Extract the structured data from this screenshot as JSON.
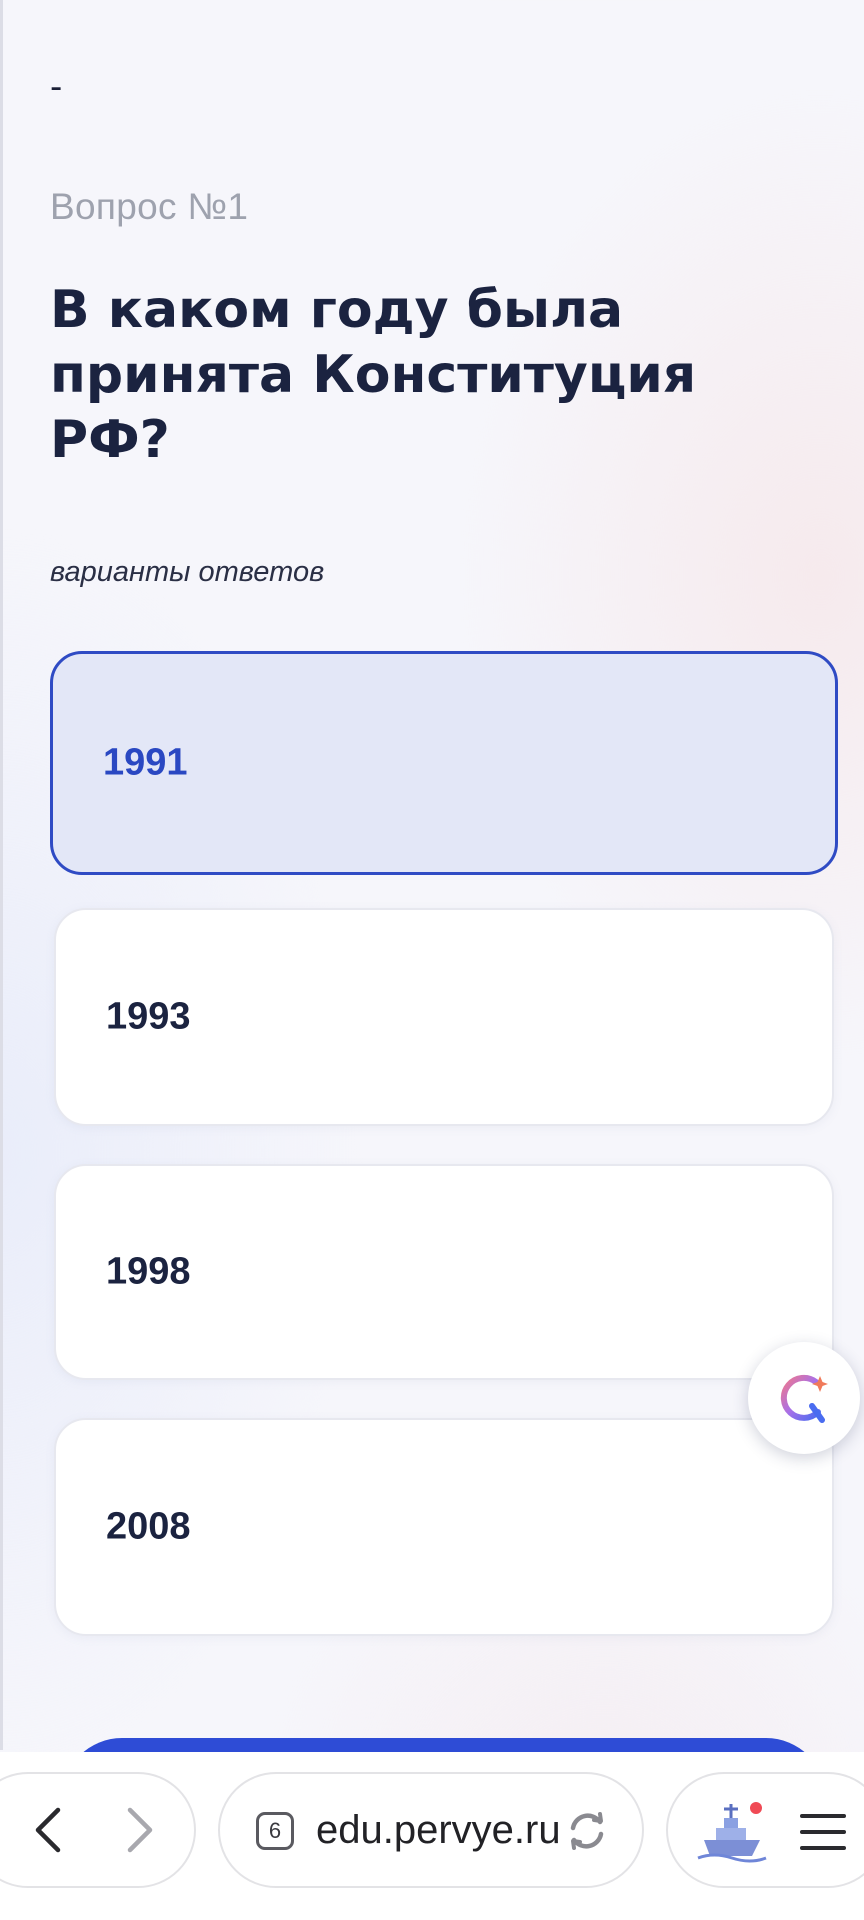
{
  "header": {
    "dash": "-",
    "question_number": "Вопрос №1",
    "question_title": "В каком году была принята Конституция РФ?",
    "answers_label": "варианты ответов"
  },
  "options": [
    {
      "label": "1991",
      "selected": true
    },
    {
      "label": "1993",
      "selected": false
    },
    {
      "label": "1998",
      "selected": false
    },
    {
      "label": "2008",
      "selected": false
    }
  ],
  "browser": {
    "back_icon": "chevron-left-icon",
    "forward_icon": "chevron-right-icon",
    "tab_count": "6",
    "url": "edu.pervye.ru",
    "reload_icon": "reload-icon",
    "profile_icon": "ship-icon",
    "menu_icon": "hamburger-icon"
  },
  "colors": {
    "accent": "#2e4cd6",
    "selected_bg": "#e3e7f7",
    "title": "#1b2340",
    "muted": "#9ea2ae",
    "notification_dot": "#f04a55"
  }
}
